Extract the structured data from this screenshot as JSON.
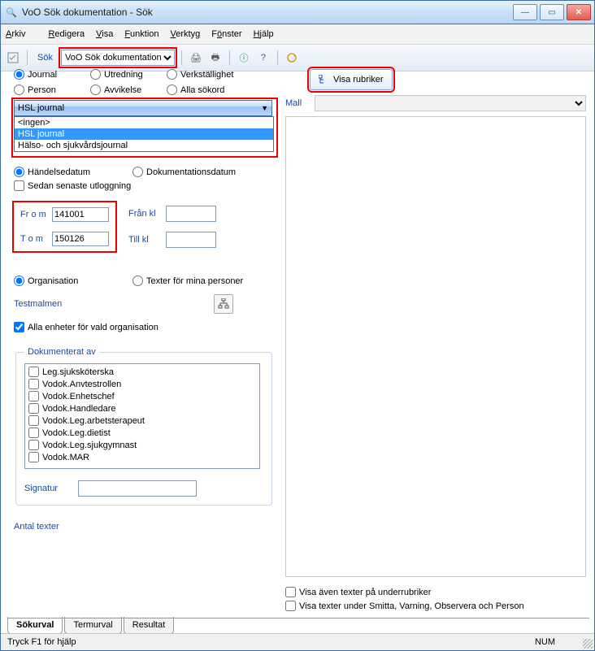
{
  "window": {
    "title": "VoO Sök dokumentation - Sök"
  },
  "menu": {
    "arkiv": "Arkiv",
    "redigera": "Redigera",
    "visa": "Visa",
    "funktion": "Funktion",
    "verktyg": "Verktyg",
    "fonster": "Fönster",
    "hjalp": "Hjälp"
  },
  "toolbar": {
    "sok_label": "Sök",
    "combo_value": "VoO Sök dokumentation"
  },
  "radios": {
    "journal": "Journal",
    "utredning": "Utredning",
    "verkstallighet": "Verkställighet",
    "person": "Person",
    "avvikelse": "Avvikelse",
    "allasokord": "Alla sökord"
  },
  "journal_combo": {
    "value": "HSL journal",
    "options": [
      "<ingen>",
      "HSL journal",
      "Hälso- och sjukvårdsjournal"
    ]
  },
  "date_section": {
    "handelsedatum": "Händelsedatum",
    "dokdatum": "Dokumentationsdatum",
    "sedan": "Sedan senaste utloggning",
    "from_lbl": "Fr o m",
    "from_val": "141001",
    "tom_lbl": "T o m",
    "tom_val": "150126",
    "frankl": "Från kl",
    "tillkl": "Till kl"
  },
  "org_section": {
    "organisation": "Organisation",
    "texter_mina": "Texter för mina personer",
    "testmalmen": "Testmalmen",
    "alla_enheter": "Alla enheter för vald organisation"
  },
  "dok": {
    "legend": "Dokumenterat av",
    "items": [
      "Leg.sjuksköterska",
      "Vodok.Anvtestrollen",
      "Vodok.Enhetschef",
      "Vodok.Handledare",
      "Vodok.Leg.arbetsterapeut",
      "Vodok.Leg.dietist",
      "Vodok.Leg.sjukgymnast",
      "Vodok.MAR"
    ],
    "signatur": "Signatur"
  },
  "antal": "Antal texter",
  "right": {
    "visa_rubriker": "Visa rubriker",
    "mall": "Mall",
    "visa_aven": "Visa även texter på underrubriker",
    "visa_smitta": "Visa texter under Smitta, Varning, Observera och Person"
  },
  "tabs": {
    "sokurval": "Sökurval",
    "termurval": "Termurval",
    "resultat": "Resultat"
  },
  "status": {
    "help": "Tryck F1 för hjälp",
    "num": "NUM"
  }
}
